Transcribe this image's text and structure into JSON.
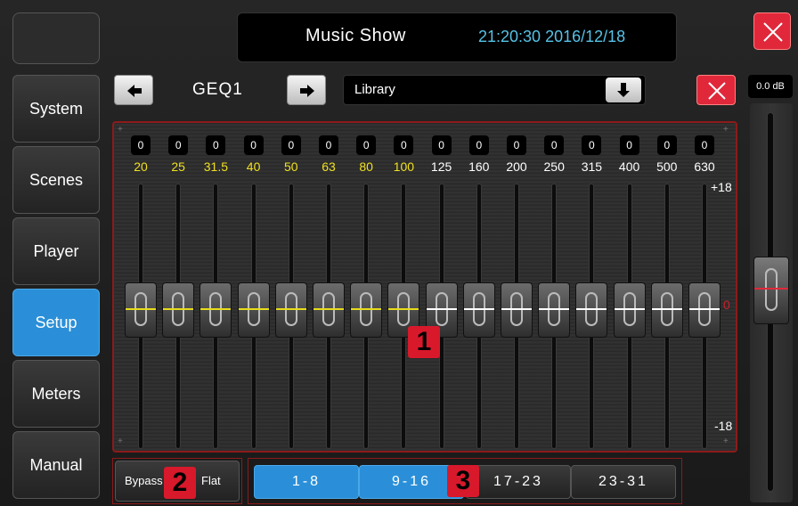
{
  "header": {
    "title": "Music Show",
    "clock": "21:20:30 2016/12/18"
  },
  "sidebar": {
    "items": [
      {
        "label": "System",
        "active": false
      },
      {
        "label": "Scenes",
        "active": false
      },
      {
        "label": "Player",
        "active": false
      },
      {
        "label": "Setup",
        "active": true
      },
      {
        "label": "Meters",
        "active": false
      },
      {
        "label": "Manual",
        "active": false
      }
    ]
  },
  "geq": {
    "name": "GEQ1",
    "library_label": "Library",
    "bands": [
      {
        "freq": "20",
        "value": "0"
      },
      {
        "freq": "25",
        "value": "0"
      },
      {
        "freq": "31.5",
        "value": "0"
      },
      {
        "freq": "40",
        "value": "0"
      },
      {
        "freq": "50",
        "value": "0"
      },
      {
        "freq": "63",
        "value": "0"
      },
      {
        "freq": "80",
        "value": "0"
      },
      {
        "freq": "100",
        "value": "0"
      },
      {
        "freq": "125",
        "value": "0"
      },
      {
        "freq": "160",
        "value": "0"
      },
      {
        "freq": "200",
        "value": "0"
      },
      {
        "freq": "250",
        "value": "0"
      },
      {
        "freq": "315",
        "value": "0"
      },
      {
        "freq": "400",
        "value": "0"
      },
      {
        "freq": "500",
        "value": "0"
      },
      {
        "freq": "630",
        "value": "0"
      }
    ],
    "scale_top": "+18",
    "scale_mid": "0",
    "scale_bottom": "-18"
  },
  "markers": {
    "m1": "1",
    "m2": "2",
    "m3": "3"
  },
  "bottom": {
    "bypass_label": "Bypass",
    "flat_label": "Flat",
    "pages": [
      {
        "label": "1-8",
        "active": true
      },
      {
        "label": "9-16",
        "active": true
      },
      {
        "label": "17-23",
        "active": false
      },
      {
        "label": "23-31",
        "active": false
      }
    ]
  },
  "master": {
    "label": "0.0 dB"
  },
  "colors": {
    "accent_blue": "#2a8fd8",
    "clock_blue": "#56c2e6",
    "close_red": "#e0283a",
    "freq_yellow": "#f0e020",
    "knob_yellow": "#e8dc1a",
    "knob_white": "#ffffff",
    "master_red": "#e0283a"
  },
  "icons": {
    "close": "close-icon",
    "prev": "arrow-left-icon",
    "next": "arrow-right-icon",
    "library": "arrow-down-icon"
  }
}
